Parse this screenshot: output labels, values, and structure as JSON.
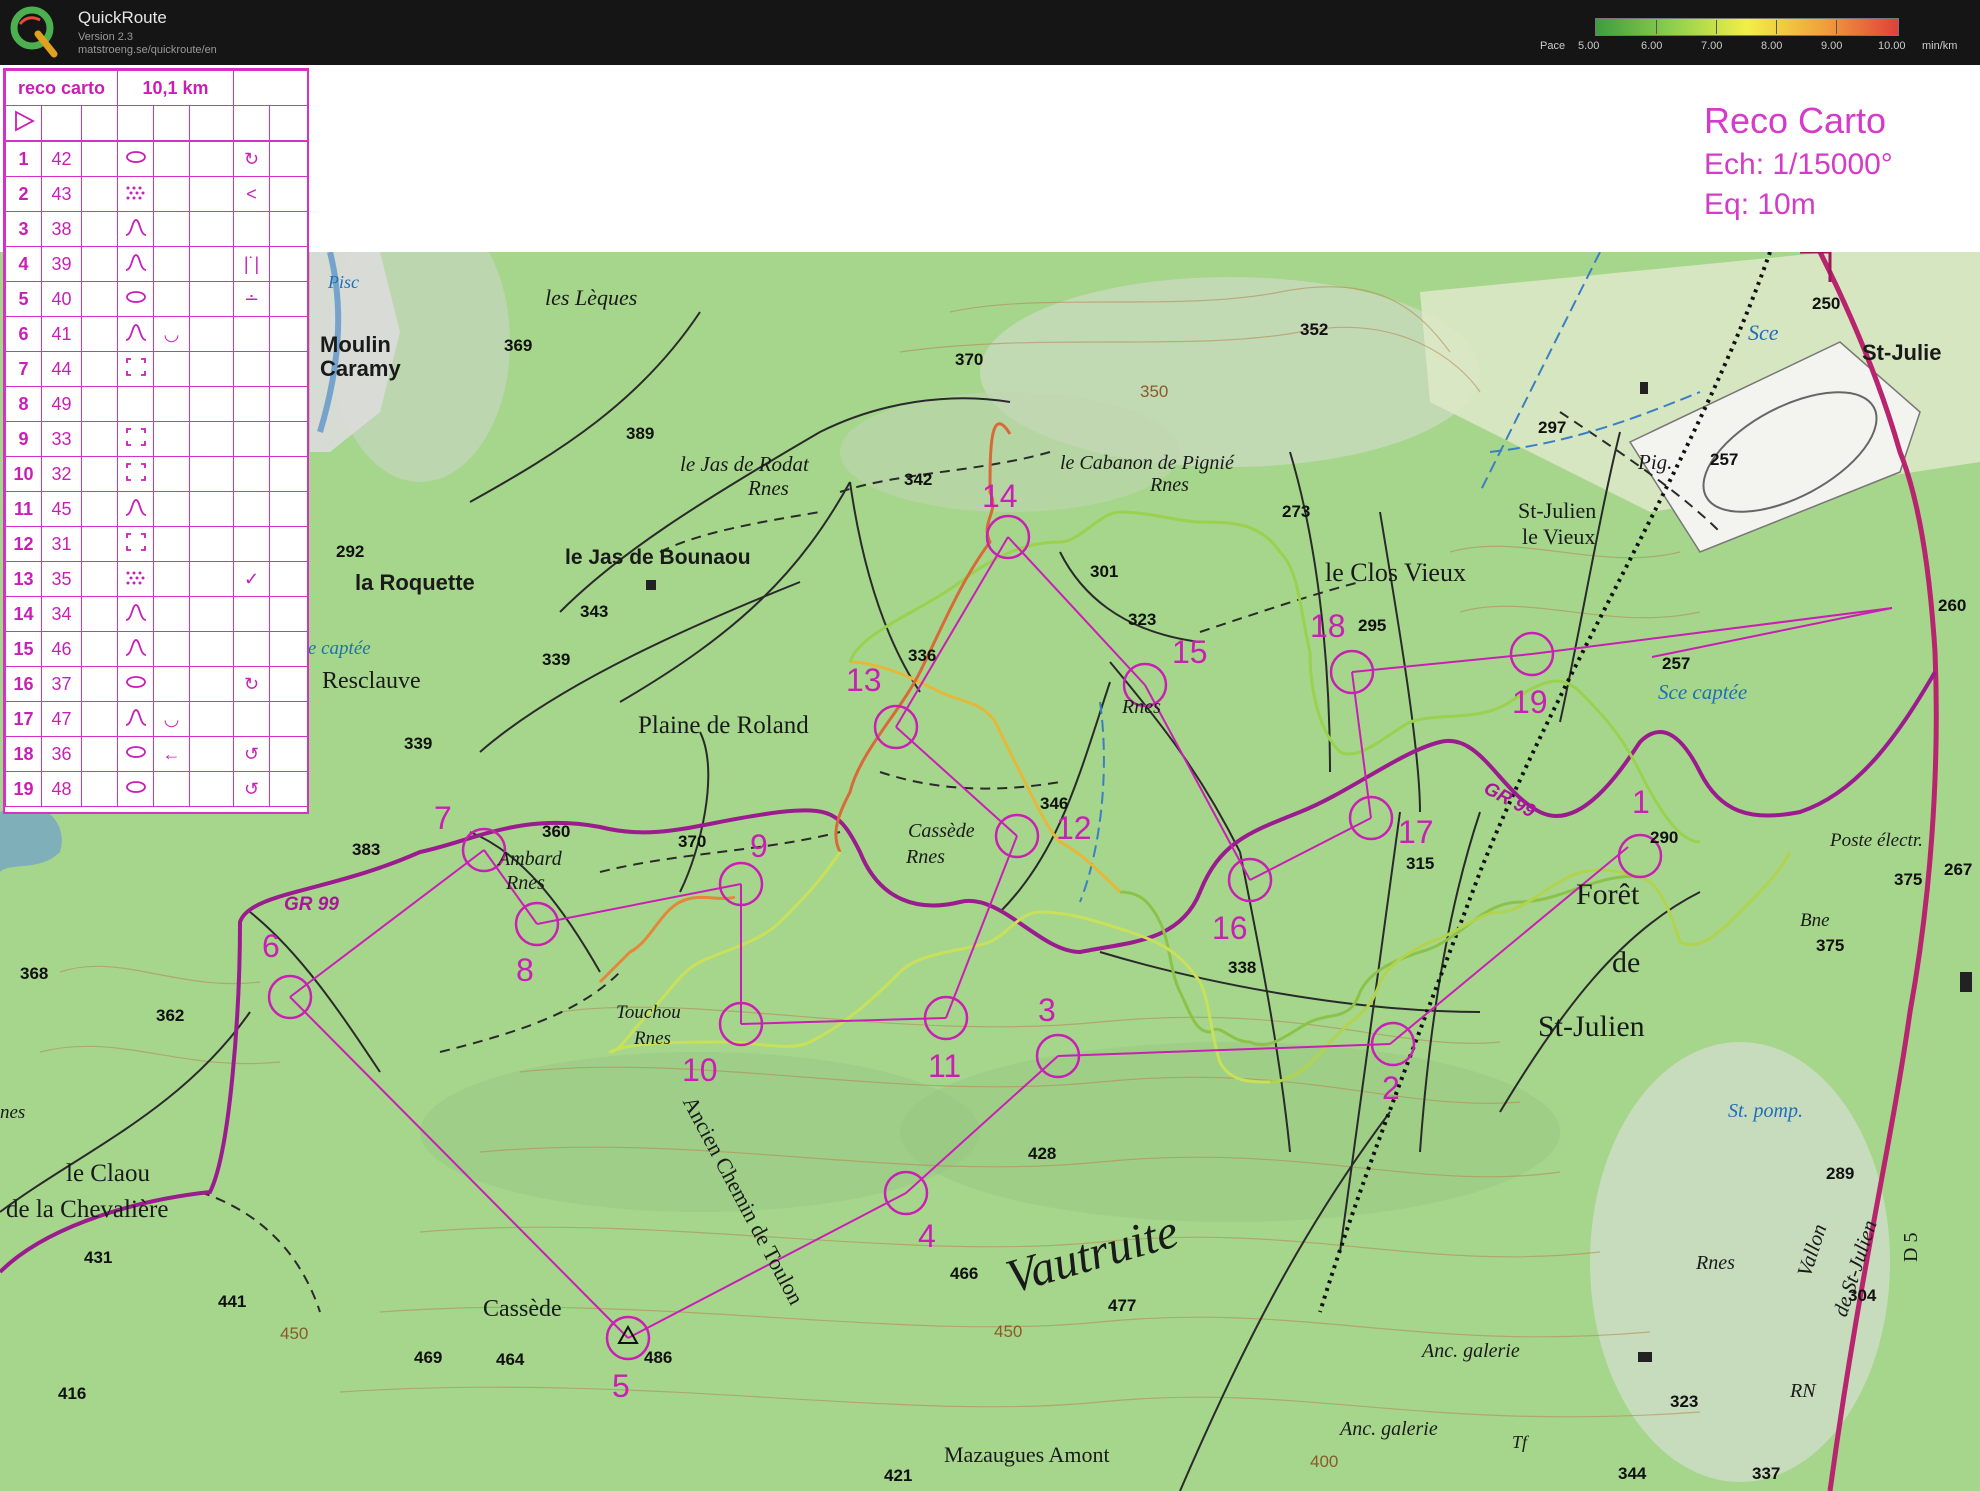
{
  "app": {
    "name": "QuickRoute",
    "version": "Version 2.3",
    "url": "matstroeng.se/quickroute/en"
  },
  "pace_legend": {
    "label": "Pace",
    "values": [
      "5.00",
      "6.00",
      "7.00",
      "8.00",
      "9.00",
      "10.00"
    ],
    "unit": "min/km",
    "colors": {
      "fast": "#3e9c3e",
      "medium": "#f2ef48",
      "slow": "#e0403a"
    }
  },
  "course": {
    "title": "Reco Carto",
    "scale": "Ech: 1/15000°",
    "equidistance": "Eq: 10m",
    "name": "reco carto",
    "length": "10,1 km",
    "color": "#d53bc9"
  },
  "description_sheet": {
    "start_symbol": "triangle",
    "rows": [
      {
        "num": "1",
        "code": "42",
        "feature": "elongated-knoll",
        "detail": "",
        "location": "",
        "extra": "↻"
      },
      {
        "num": "2",
        "code": "43",
        "feature": "rocky-ground",
        "detail": "",
        "location": "",
        "extra": "<"
      },
      {
        "num": "3",
        "code": "38",
        "feature": "spur",
        "detail": "",
        "location": "",
        "extra": ""
      },
      {
        "num": "4",
        "code": "39",
        "feature": "spur",
        "detail": "",
        "location": "",
        "extra": "|˙|"
      },
      {
        "num": "5",
        "code": "40",
        "feature": "elongated-knoll",
        "detail": "",
        "location": "",
        "extra": "∸"
      },
      {
        "num": "6",
        "code": "41",
        "feature": "spur",
        "detail": "◡",
        "location": "",
        "extra": ""
      },
      {
        "num": "7",
        "code": "44",
        "feature": "ruin",
        "detail": "",
        "location": "",
        "extra": ""
      },
      {
        "num": "8",
        "code": "49",
        "feature": "",
        "detail": "",
        "location": "",
        "extra": ""
      },
      {
        "num": "9",
        "code": "33",
        "feature": "ruin",
        "detail": "",
        "location": "",
        "extra": ""
      },
      {
        "num": "10",
        "code": "32",
        "feature": "ruin",
        "detail": "",
        "location": "",
        "extra": ""
      },
      {
        "num": "11",
        "code": "45",
        "feature": "spur",
        "detail": "",
        "location": "",
        "extra": ""
      },
      {
        "num": "12",
        "code": "31",
        "feature": "ruin",
        "detail": "",
        "location": "",
        "extra": ""
      },
      {
        "num": "13",
        "code": "35",
        "feature": "rocky-ground",
        "detail": "",
        "location": "",
        "extra": "✓"
      },
      {
        "num": "14",
        "code": "34",
        "feature": "spur",
        "detail": "",
        "location": "",
        "extra": ""
      },
      {
        "num": "15",
        "code": "46",
        "feature": "spur",
        "detail": "",
        "location": "",
        "extra": ""
      },
      {
        "num": "16",
        "code": "37",
        "feature": "elongated-knoll",
        "detail": "",
        "location": "",
        "extra": "↻"
      },
      {
        "num": "17",
        "code": "47",
        "feature": "spur",
        "detail": "◡",
        "location": "",
        "extra": ""
      },
      {
        "num": "18",
        "code": "36",
        "feature": "elongated-knoll",
        "detail": "←",
        "location": "",
        "extra": "↺"
      },
      {
        "num": "19",
        "code": "48",
        "feature": "elongated-knoll",
        "detail": "",
        "location": "",
        "extra": "↺"
      }
    ]
  },
  "map": {
    "place_names": [
      {
        "text": "les Lèques"
      },
      {
        "text": "Moulin"
      },
      {
        "text": "Caramy"
      },
      {
        "text": "le Jas de Rodat"
      },
      {
        "text": "Rnes"
      },
      {
        "text": "le Cabanon de Pignié"
      },
      {
        "text": "Rnes"
      },
      {
        "text": "le Jas de Bounaou"
      },
      {
        "text": "la Roquette"
      },
      {
        "text": "St-Julien"
      },
      {
        "text": "le Vieux"
      },
      {
        "text": "le Clos Vieux"
      },
      {
        "text": "St-Julie"
      },
      {
        "text": "Pig."
      },
      {
        "text": "Resclauve"
      },
      {
        "text": "Plaine de Roland"
      },
      {
        "text": "Cassède"
      },
      {
        "text": "Rnes"
      },
      {
        "text": "Rnes"
      },
      {
        "text": "Ambard"
      },
      {
        "text": "Rnes"
      },
      {
        "text": "Touchou"
      },
      {
        "text": "Rnes"
      },
      {
        "text": "Forêt"
      },
      {
        "text": "de"
      },
      {
        "text": "St-Julien"
      },
      {
        "text": "Poste électr."
      },
      {
        "text": "Bne"
      },
      {
        "text": "le Claou"
      },
      {
        "text": "de la Chevalière"
      },
      {
        "text": "Vautruite"
      },
      {
        "text": "Cassède"
      },
      {
        "text": "Ancien Chemin de Toulon"
      },
      {
        "text": "Mazaugues Amont"
      },
      {
        "text": "Anc. galerie"
      },
      {
        "text": "Anc. galerie"
      },
      {
        "text": "Rnes"
      },
      {
        "text": "Vallon"
      },
      {
        "text": "de St-Julien"
      },
      {
        "text": "D 5"
      },
      {
        "text": "RN"
      },
      {
        "text": "Tf"
      },
      {
        "text": "nes"
      }
    ],
    "water_names": [
      "Sce",
      "Sce captée",
      "Sce captée",
      "St. pomp.",
      "Pisc"
    ],
    "spot_heights": [
      "352",
      "370",
      "369",
      "389",
      "342",
      "301",
      "323",
      "336",
      "273",
      "297",
      "257",
      "250",
      "260",
      "257",
      "292",
      "343",
      "339",
      "339",
      "346",
      "295",
      "315",
      "290",
      "375",
      "267",
      "375",
      "383",
      "360",
      "370",
      "368",
      "362",
      "338",
      "428",
      "466",
      "477",
      "431",
      "441",
      "469",
      "464",
      "486",
      "416",
      "289",
      "304",
      "323",
      "344",
      "337",
      "421",
      "350",
      "450",
      "450",
      "400"
    ],
    "trail_label": "GR 99",
    "controls": [
      "1",
      "2",
      "3",
      "4",
      "5",
      "6",
      "7",
      "8",
      "9",
      "10",
      "11",
      "12",
      "13",
      "14",
      "15",
      "16",
      "17",
      "18",
      "19"
    ]
  }
}
